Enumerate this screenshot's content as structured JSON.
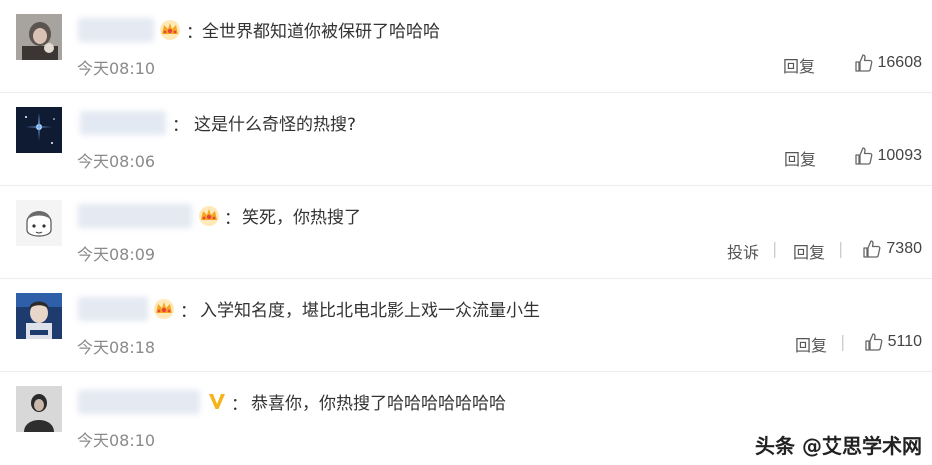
{
  "comments": [
    {
      "text": "全世界都知道你被保研了哈哈哈",
      "time": "今天08:10",
      "reply": "回复",
      "likes": "16608",
      "badge": "crown-icon"
    },
    {
      "text": "这是什么奇怪的热搜?",
      "time": "今天08:06",
      "reply": "回复",
      "likes": "10093",
      "badge": ""
    },
    {
      "text": "笑死，你热搜了",
      "time": "今天08:09",
      "report": "投诉",
      "reply": "回复",
      "likes": "7380",
      "badge": "crown-icon"
    },
    {
      "text": "入学知名度，堪比北电北影上戏一众流量小生",
      "time": "今天08:18",
      "reply": "回复",
      "likes": "5110",
      "badge": "crown-icon"
    },
    {
      "text": "恭喜你，你热搜了哈哈哈哈哈哈哈",
      "time": "今天08:10",
      "badge": "verified-v-icon"
    }
  ],
  "colon": "：",
  "watermark": {
    "text": "头条 @艾思学术网"
  },
  "colors": {
    "crown_gold": "#f5a623",
    "crown_red": "#e8443a",
    "verified_v": "#f6b21b",
    "name_blur": "#dfe6f1"
  }
}
